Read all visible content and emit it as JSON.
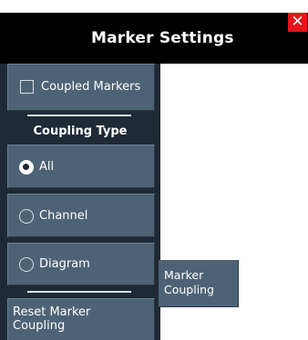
{
  "window": {
    "title": "Marker Settings",
    "close_symbol": "✕",
    "close_color": "#e8131b"
  },
  "panel": {
    "coupled_markers": {
      "label": "Coupled Markers",
      "checked": false
    },
    "coupling_type_heading": "Coupling Type",
    "options": [
      {
        "label": "All",
        "selected": true
      },
      {
        "label": "Channel",
        "selected": false
      },
      {
        "label": "Diagram",
        "selected": false
      }
    ],
    "reset_button": {
      "line1": "Reset Marker",
      "line2": "Coupling"
    }
  },
  "tooltip": {
    "line1": "Marker",
    "line2": "Coupling"
  },
  "colors": {
    "panel_bg": "#1f2a36",
    "button_bg": "#4d6275",
    "titlebar_bg": "#000000"
  }
}
